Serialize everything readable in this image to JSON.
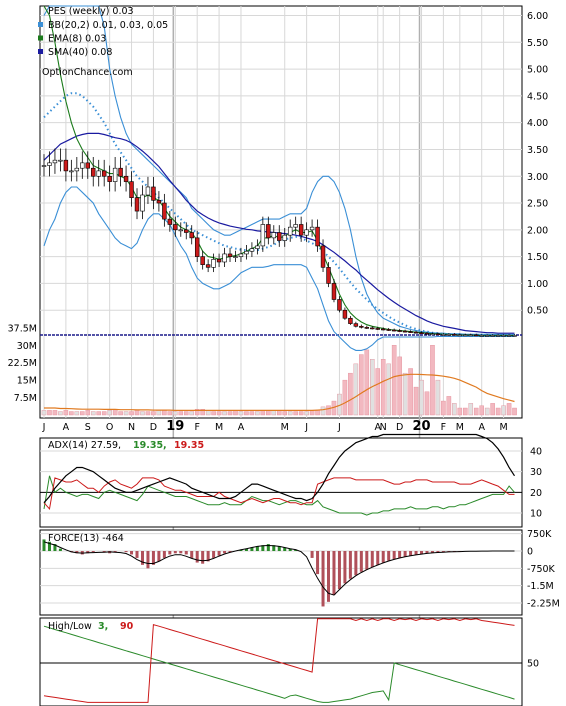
{
  "chart_data": [
    {
      "type": "candlestick",
      "panel": "price",
      "title": "PES (weekly) 0.03",
      "legend": [
        {
          "label": "BB(20,2) 0.01, 0.03, 0.05",
          "color": "#3a8fd6"
        },
        {
          "label": "EMA(8) 0.03",
          "color": "#1a7a1a"
        },
        {
          "label": "SMA(40) 0.08",
          "color": "#1a1aa0"
        }
      ],
      "watermark": "OptionChance.com",
      "ylim": [
        0,
        6.2
      ],
      "y_ticks": [
        "6.00",
        "5.50",
        "5.00",
        "4.50",
        "4.00",
        "3.50",
        "3.00",
        "2.50",
        "2.00",
        "1.50",
        "1.00",
        "0.50"
      ],
      "volume_ticks": [
        "37.5M",
        "30M",
        "22.5M",
        "15M",
        "7.5M"
      ],
      "volume_ylim": [
        0,
        40
      ],
      "x_labels": [
        "J",
        "A",
        "S",
        "O",
        "N",
        "D",
        "19",
        "F",
        "M",
        "A",
        "M",
        "J",
        "J",
        "A",
        "N",
        "D",
        "20",
        "F",
        "M",
        "A",
        "M"
      ],
      "x_positions": [
        0,
        4,
        8,
        12,
        16,
        20,
        24,
        28,
        32,
        36,
        44,
        48,
        54,
        61,
        62,
        65,
        69,
        73,
        76,
        80,
        84
      ],
      "weeks": 87,
      "close": [
        3.2,
        3.25,
        3.3,
        3.3,
        3.1,
        3.1,
        3.15,
        3.25,
        3.15,
        3.0,
        3.1,
        3.0,
        2.9,
        3.15,
        3.0,
        2.9,
        2.6,
        2.35,
        2.65,
        2.8,
        2.55,
        2.5,
        2.2,
        2.1,
        2.0,
        2.0,
        1.95,
        1.85,
        1.5,
        1.35,
        1.3,
        1.45,
        1.4,
        1.55,
        1.5,
        1.5,
        1.55,
        1.6,
        1.65,
        1.7,
        2.1,
        1.85,
        1.95,
        1.8,
        1.9,
        2.05,
        2.1,
        1.9,
        2.0,
        2.05,
        1.7,
        1.3,
        1.0,
        0.7,
        0.5,
        0.35,
        0.25,
        0.2,
        0.18,
        0.17,
        0.16,
        0.15,
        0.14,
        0.13,
        0.12,
        0.11,
        0.1,
        0.09,
        0.08,
        0.07,
        0.06,
        0.06,
        0.05,
        0.05,
        0.05,
        0.04,
        0.04,
        0.04,
        0.04,
        0.03,
        0.03,
        0.03,
        0.03,
        0.03,
        0.03,
        0.03,
        0.03
      ],
      "bb_mid": [
        4.1,
        4.2,
        4.3,
        4.4,
        4.5,
        4.55,
        4.55,
        4.5,
        4.4,
        4.3,
        4.15,
        4.0,
        3.8,
        3.6,
        3.45,
        3.3,
        3.15,
        3.0,
        2.9,
        2.8,
        2.7,
        2.6,
        2.5,
        2.4,
        2.3,
        2.2,
        2.1,
        2.0,
        1.95,
        1.9,
        1.85,
        1.8,
        1.75,
        1.7,
        1.68,
        1.65,
        1.63,
        1.62,
        1.62,
        1.62,
        1.65,
        1.68,
        1.72,
        1.78,
        1.82,
        1.85,
        1.87,
        1.85,
        1.8,
        1.75,
        1.7,
        1.6,
        1.5,
        1.4,
        1.28,
        1.15,
        1.02,
        0.9,
        0.8,
        0.7,
        0.6,
        0.52,
        0.45,
        0.38,
        0.32,
        0.27,
        0.22,
        0.18,
        0.15,
        0.12,
        0.1,
        0.08,
        0.07,
        0.06,
        0.05,
        0.05,
        0.05,
        0.04,
        0.04,
        0.04,
        0.04,
        0.04,
        0.03,
        0.03,
        0.03,
        0.03,
        0.03
      ],
      "bb_upper": [
        6.0,
        6.2,
        6.5,
        6.8,
        7.0,
        7.0,
        7.0,
        7.0,
        6.8,
        6.5,
        6.2,
        5.8,
        5.0,
        4.5,
        4.1,
        3.8,
        3.6,
        3.5,
        3.4,
        3.3,
        3.2,
        3.1,
        3.0,
        2.9,
        2.8,
        2.7,
        2.6,
        2.4,
        2.3,
        2.2,
        2.1,
        2.0,
        1.95,
        1.9,
        1.9,
        1.95,
        2.0,
        2.05,
        2.1,
        2.15,
        2.2,
        2.2,
        2.2,
        2.2,
        2.25,
        2.3,
        2.3,
        2.3,
        2.4,
        2.7,
        2.9,
        3.0,
        3.0,
        2.9,
        2.7,
        2.4,
        2.0,
        1.5,
        1.1,
        0.8,
        0.6,
        0.45,
        0.35,
        0.3,
        0.25,
        0.2,
        0.17,
        0.14,
        0.12,
        0.1,
        0.09,
        0.08,
        0.07,
        0.07,
        0.06,
        0.06,
        0.06,
        0.05,
        0.05,
        0.05,
        0.05,
        0.05,
        0.05,
        0.05,
        0.05,
        0.05,
        0.05
      ],
      "bb_lower": [
        1.7,
        2.0,
        2.2,
        2.5,
        2.7,
        2.8,
        2.8,
        2.7,
        2.6,
        2.5,
        2.3,
        2.15,
        2.0,
        1.85,
        1.75,
        1.7,
        1.65,
        1.75,
        2.0,
        2.2,
        2.3,
        2.3,
        2.2,
        2.1,
        1.9,
        1.7,
        1.55,
        1.3,
        1.1,
        1.0,
        0.95,
        0.9,
        0.9,
        0.95,
        1.0,
        1.1,
        1.2,
        1.25,
        1.3,
        1.3,
        1.3,
        1.32,
        1.35,
        1.35,
        1.35,
        1.35,
        1.35,
        1.35,
        1.3,
        1.1,
        0.9,
        0.6,
        0.3,
        0.1,
        0.0,
        -0.1,
        -0.2,
        -0.25,
        -0.25,
        -0.22,
        -0.15,
        -0.05,
        0.0,
        0.0,
        0.0,
        0.0,
        0.0,
        0.0,
        0.0,
        0.0,
        0.0,
        0.0,
        0.01,
        0.01,
        0.01,
        0.01,
        0.01,
        0.01,
        0.01,
        0.01,
        0.01,
        0.01,
        0.01,
        0.01,
        0.01,
        0.01,
        0.01
      ],
      "ema8": [
        6.5,
        6.0,
        5.5,
        4.9,
        4.4,
        4.0,
        3.7,
        3.5,
        3.35,
        3.2,
        3.15,
        3.1,
        3.05,
        3.05,
        3.0,
        2.95,
        2.8,
        2.6,
        2.6,
        2.65,
        2.6,
        2.55,
        2.4,
        2.25,
        2.15,
        2.05,
        2.0,
        1.95,
        1.8,
        1.6,
        1.5,
        1.48,
        1.45,
        1.48,
        1.5,
        1.52,
        1.55,
        1.6,
        1.65,
        1.7,
        1.85,
        1.85,
        1.9,
        1.85,
        1.88,
        1.95,
        2.0,
        1.95,
        1.95,
        1.98,
        1.8,
        1.55,
        1.3,
        1.05,
        0.8,
        0.6,
        0.45,
        0.35,
        0.28,
        0.23,
        0.2,
        0.18,
        0.16,
        0.14,
        0.13,
        0.12,
        0.11,
        0.1,
        0.09,
        0.08,
        0.07,
        0.06,
        0.06,
        0.05,
        0.05,
        0.04,
        0.04,
        0.04,
        0.04,
        0.03,
        0.03,
        0.03,
        0.03,
        0.03,
        0.03,
        0.03,
        0.03
      ],
      "sma40": [
        3.3,
        3.4,
        3.5,
        3.6,
        3.65,
        3.7,
        3.75,
        3.78,
        3.8,
        3.8,
        3.8,
        3.78,
        3.75,
        3.72,
        3.7,
        3.67,
        3.62,
        3.55,
        3.47,
        3.38,
        3.28,
        3.18,
        3.05,
        2.92,
        2.8,
        2.68,
        2.55,
        2.45,
        2.35,
        2.28,
        2.22,
        2.17,
        2.13,
        2.1,
        2.07,
        2.05,
        2.03,
        2.01,
        2.0,
        1.98,
        1.97,
        1.96,
        1.95,
        1.94,
        1.93,
        1.92,
        1.9,
        1.88,
        1.85,
        1.82,
        1.78,
        1.72,
        1.65,
        1.58,
        1.5,
        1.42,
        1.33,
        1.25,
        1.15,
        1.06,
        0.97,
        0.88,
        0.8,
        0.72,
        0.65,
        0.58,
        0.52,
        0.46,
        0.4,
        0.35,
        0.3,
        0.26,
        0.23,
        0.2,
        0.18,
        0.16,
        0.14,
        0.12,
        0.11,
        0.1,
        0.09,
        0.08,
        0.08,
        0.07,
        0.07,
        0.07,
        0.07
      ],
      "volume": [
        2,
        2,
        2,
        1.5,
        2,
        1.5,
        1.5,
        1.5,
        2,
        1.5,
        1.5,
        1.5,
        2,
        2.5,
        1.5,
        1.5,
        1.5,
        2,
        1.5,
        1.5,
        1.5,
        2,
        2,
        1.5,
        1.5,
        1.5,
        1.5,
        1.5,
        2.5,
        2.5,
        2,
        1.5,
        1.5,
        1.5,
        1.5,
        2,
        1.5,
        1.5,
        1.5,
        1.5,
        2,
        2,
        2,
        2,
        1.5,
        1.5,
        1.5,
        1.5,
        1.5,
        2,
        2,
        3.5,
        4,
        6,
        9,
        15,
        18,
        22,
        26,
        28,
        24,
        20,
        24,
        22,
        30,
        25,
        18,
        20,
        12,
        15,
        10,
        30,
        15,
        6,
        8,
        5,
        3,
        3,
        5,
        3,
        4,
        3,
        5,
        3,
        4,
        5,
        3
      ],
      "volume_ma": [
        3,
        3,
        3,
        2.8,
        2.8,
        2.7,
        2.6,
        2.5,
        2.5,
        2.5,
        2.5,
        2.4,
        2.4,
        2.4,
        2.3,
        2.3,
        2.3,
        2.2,
        2.2,
        2.2,
        2.1,
        2.1,
        2.1,
        2.1,
        2.0,
        2.0,
        2.0,
        2.0,
        2.0,
        2.0,
        2.0,
        2.0,
        2.0,
        2.0,
        2.0,
        2.0,
        2.0,
        2.0,
        2.0,
        2.0,
        2.0,
        2.0,
        2.0,
        2.0,
        2.0,
        2.0,
        2.0,
        2.0,
        2.0,
        2.0,
        2.1,
        2.3,
        2.7,
        3.3,
        4.1,
        5.2,
        6.5,
        7.9,
        9.4,
        10.9,
        12.2,
        13.3,
        14.5,
        15.5,
        16.5,
        17.0,
        17.3,
        17.5,
        17.5,
        17.4,
        17.3,
        17.2,
        17.0,
        16.7,
        16.3,
        15.8,
        15.0,
        14.0,
        13.0,
        12.0,
        10.5,
        9.3,
        8.5,
        7.8,
        7.0,
        6.4,
        5.8
      ]
    },
    {
      "type": "line",
      "panel": "adx",
      "title": "ADX(14) 27.59,",
      "plus_di_label": "19.35,",
      "minus_di_label": "19.35",
      "colors": {
        "adx": "#000000",
        "plus_di": "#2a8a2a",
        "minus_di": "#cc1a1a"
      },
      "ylim": [
        5,
        50
      ],
      "y_ticks": [
        "40",
        "30",
        "20",
        "10"
      ],
      "adx": [
        15,
        18,
        22,
        25,
        28,
        30,
        32,
        32,
        31,
        30,
        28,
        26,
        24,
        22,
        21,
        20,
        20,
        21,
        22,
        23,
        24,
        25,
        26,
        27,
        26,
        25,
        24,
        22,
        21,
        20,
        19,
        18,
        17,
        17,
        17,
        18,
        20,
        22,
        24,
        24,
        23,
        22,
        21,
        20,
        19,
        18,
        17,
        17,
        16,
        17,
        20,
        24,
        29,
        33,
        37,
        40,
        42,
        44,
        45,
        46,
        47,
        47,
        48,
        48,
        48,
        48,
        48,
        48,
        48,
        48,
        48,
        48,
        48,
        48,
        48,
        48,
        48,
        48,
        48,
        48,
        47,
        46,
        44,
        41,
        37,
        32,
        28
      ],
      "plus_di": [
        12,
        28,
        20,
        22,
        20,
        19,
        18,
        19,
        19,
        18,
        17,
        20,
        21,
        20,
        19,
        18,
        17,
        16,
        19,
        23,
        22,
        21,
        20,
        19,
        18,
        18,
        18,
        17,
        16,
        15,
        14,
        14,
        14,
        15,
        14,
        14,
        14,
        16,
        18,
        17,
        16,
        16,
        15,
        14,
        15,
        16,
        16,
        15,
        14,
        14,
        16,
        13,
        12,
        11,
        10,
        10,
        10,
        10,
        10,
        9,
        10,
        10,
        11,
        11,
        12,
        12,
        12,
        13,
        12,
        12,
        12,
        13,
        13,
        12,
        13,
        13,
        14,
        14,
        15,
        16,
        17,
        18,
        19,
        19,
        19,
        23,
        20
      ],
      "minus_di": [
        15,
        12,
        27,
        26,
        25,
        25,
        26,
        24,
        22,
        22,
        20,
        23,
        25,
        26,
        24,
        23,
        22,
        24,
        27,
        27,
        27,
        26,
        23,
        22,
        21,
        21,
        20,
        19,
        18,
        18,
        18,
        18,
        20,
        18,
        17,
        16,
        15,
        16,
        17,
        16,
        15,
        16,
        17,
        17,
        16,
        15,
        15,
        14,
        15,
        15,
        24,
        25,
        26,
        27,
        27,
        27,
        27,
        26,
        26,
        26,
        26,
        26,
        26,
        25,
        24,
        24,
        25,
        25,
        26,
        26,
        26,
        25,
        25,
        25,
        25,
        25,
        24,
        24,
        24,
        25,
        26,
        25,
        24,
        23,
        21,
        19,
        19
      ]
    },
    {
      "type": "bar",
      "panel": "force",
      "title": "FORCE(13) -464",
      "ylim": [
        -2.6,
        1.0
      ],
      "y_ticks": [
        "750K",
        "0",
        "-750K",
        "-1.5M",
        "-2.25M"
      ],
      "values": [
        0.5,
        0.4,
        0.3,
        0.1,
        0.0,
        -0.05,
        -0.1,
        -0.15,
        -0.1,
        -0.05,
        0.0,
        -0.05,
        -0.1,
        -0.05,
        0.0,
        -0.05,
        -0.15,
        -0.3,
        -0.6,
        -0.75,
        -0.6,
        -0.45,
        -0.3,
        -0.15,
        -0.1,
        -0.1,
        -0.15,
        -0.3,
        -0.5,
        -0.55,
        -0.45,
        -0.3,
        -0.2,
        -0.1,
        -0.05,
        0.0,
        0.05,
        0.1,
        0.15,
        0.2,
        0.25,
        0.3,
        0.25,
        0.2,
        0.15,
        0.1,
        0.05,
        0.0,
        0.0,
        -0.3,
        -1.0,
        -2.4,
        -2.2,
        -1.9,
        -1.65,
        -1.4,
        -1.2,
        -1.05,
        -0.9,
        -0.8,
        -0.7,
        -0.6,
        -0.5,
        -0.42,
        -0.35,
        -0.3,
        -0.25,
        -0.2,
        -0.16,
        -0.13,
        -0.1,
        -0.08,
        -0.06,
        -0.05,
        -0.04,
        -0.03,
        -0.02,
        -0.02,
        -0.01,
        -0.01,
        -0.01,
        0.0,
        0.0,
        0.0,
        0.0,
        0.0,
        0.0
      ]
    },
    {
      "type": "line",
      "panel": "highlow",
      "title": "High/Low",
      "high_label": "3,",
      "low_label": "90",
      "colors": {
        "high": "#2a8a2a",
        "low": "#cc1a1a"
      },
      "ylim": [
        0,
        105
      ],
      "y_ticks": [
        "50"
      ],
      "high": [
        95,
        93,
        91,
        89,
        87,
        85,
        83,
        81,
        79,
        77,
        75,
        73,
        71,
        69,
        67,
        65,
        63,
        61,
        59,
        57,
        55,
        53,
        51,
        49,
        47,
        45,
        43,
        41,
        39,
        37,
        35,
        33,
        31,
        29,
        27,
        25,
        23,
        21,
        19,
        17,
        15,
        13,
        11,
        9,
        7,
        10,
        11,
        9,
        7,
        5,
        3,
        2,
        2,
        3,
        4,
        5,
        6,
        8,
        10,
        12,
        14,
        15,
        16,
        5,
        50,
        48,
        46,
        44,
        42,
        40,
        38,
        36,
        34,
        32,
        30,
        28,
        26,
        24,
        22,
        20,
        18,
        16,
        14,
        12,
        10,
        8,
        6
      ],
      "low": [
        10,
        9,
        8,
        7,
        6,
        5,
        4,
        3,
        2,
        2,
        2,
        2,
        2,
        2,
        2,
        2,
        2,
        2,
        2,
        2,
        97,
        95,
        93,
        91,
        89,
        87,
        85,
        83,
        81,
        79,
        77,
        75,
        73,
        71,
        69,
        67,
        65,
        63,
        61,
        59,
        57,
        55,
        53,
        51,
        49,
        47,
        45,
        43,
        41,
        39,
        104,
        104,
        104,
        104,
        104,
        104,
        104,
        102,
        104,
        102,
        104,
        102,
        104,
        104,
        102,
        104,
        103,
        104,
        102,
        104,
        103,
        104,
        102,
        104,
        103,
        104,
        102,
        104,
        103,
        104,
        102,
        101,
        100,
        99,
        98,
        97,
        96
      ]
    }
  ]
}
